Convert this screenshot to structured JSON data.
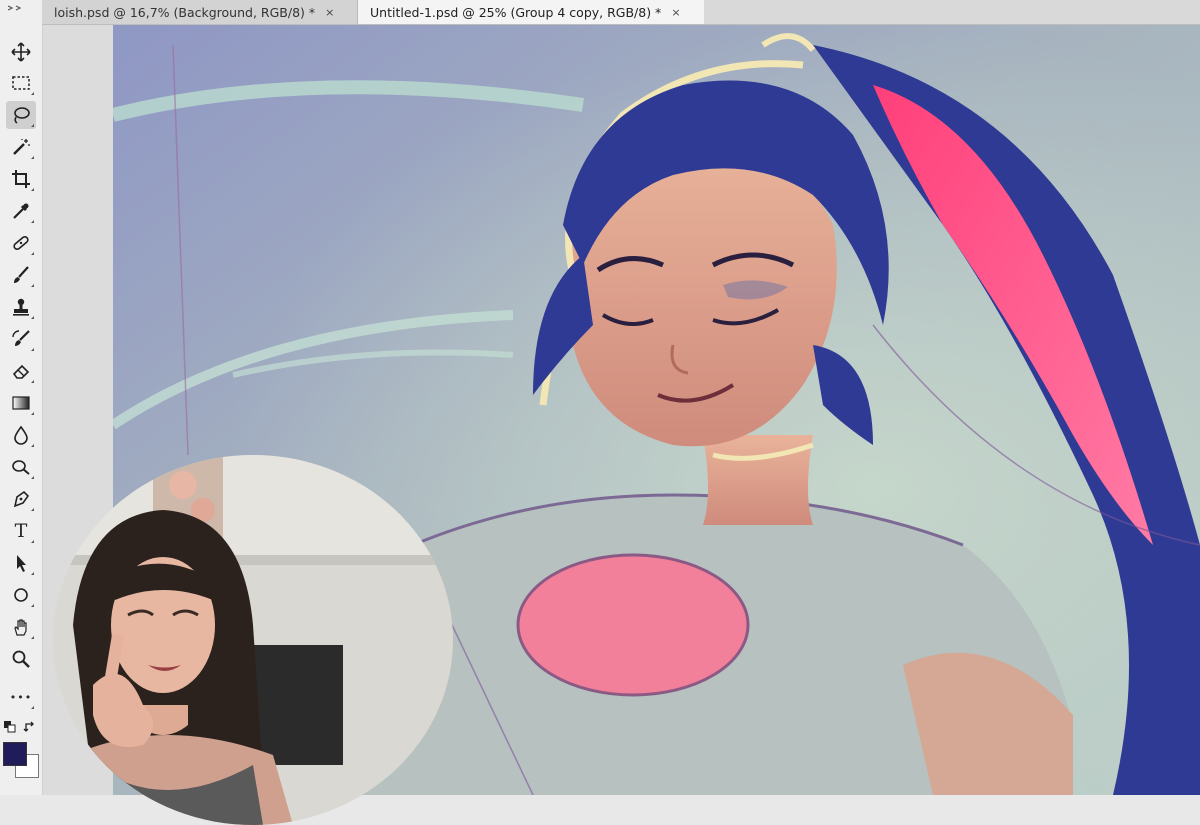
{
  "tabs": [
    {
      "label": "loish.psd @ 16,7% (Background, RGB/8) *",
      "close": "×",
      "active": false
    },
    {
      "label": "Untitled-1.psd @ 25% (Group 4 copy, RGB/8) *",
      "close": "×",
      "active": true
    }
  ],
  "toolbar": {
    "tools": [
      "move-tool",
      "rectangular-marquee-tool",
      "lasso-tool",
      "magic-wand-tool",
      "crop-tool",
      "eyedropper-tool",
      "healing-brush-tool",
      "brush-tool",
      "clone-stamp-tool",
      "history-brush-tool",
      "eraser-tool",
      "gradient-tool",
      "blur-tool",
      "dodge-tool",
      "pen-tool",
      "type-tool",
      "path-selection-tool",
      "ellipse-tool",
      "hand-tool",
      "zoom-tool",
      "more-tools"
    ],
    "active_tool": "lasso-tool",
    "type_tool_glyph": "T",
    "more_glyph": "•••",
    "foreground_color": "#201c5a",
    "background_color": "#ffffff"
  },
  "colors": {
    "canvas_bg": "#a9b6c4",
    "hair": "#2f3a8f",
    "hair_highlight": "#ff4f86",
    "skin": "#e9a98f",
    "shirt": "#b8c4c4",
    "shirt_heart": "#f27f98",
    "outline_glow": "#f1e6b4"
  }
}
